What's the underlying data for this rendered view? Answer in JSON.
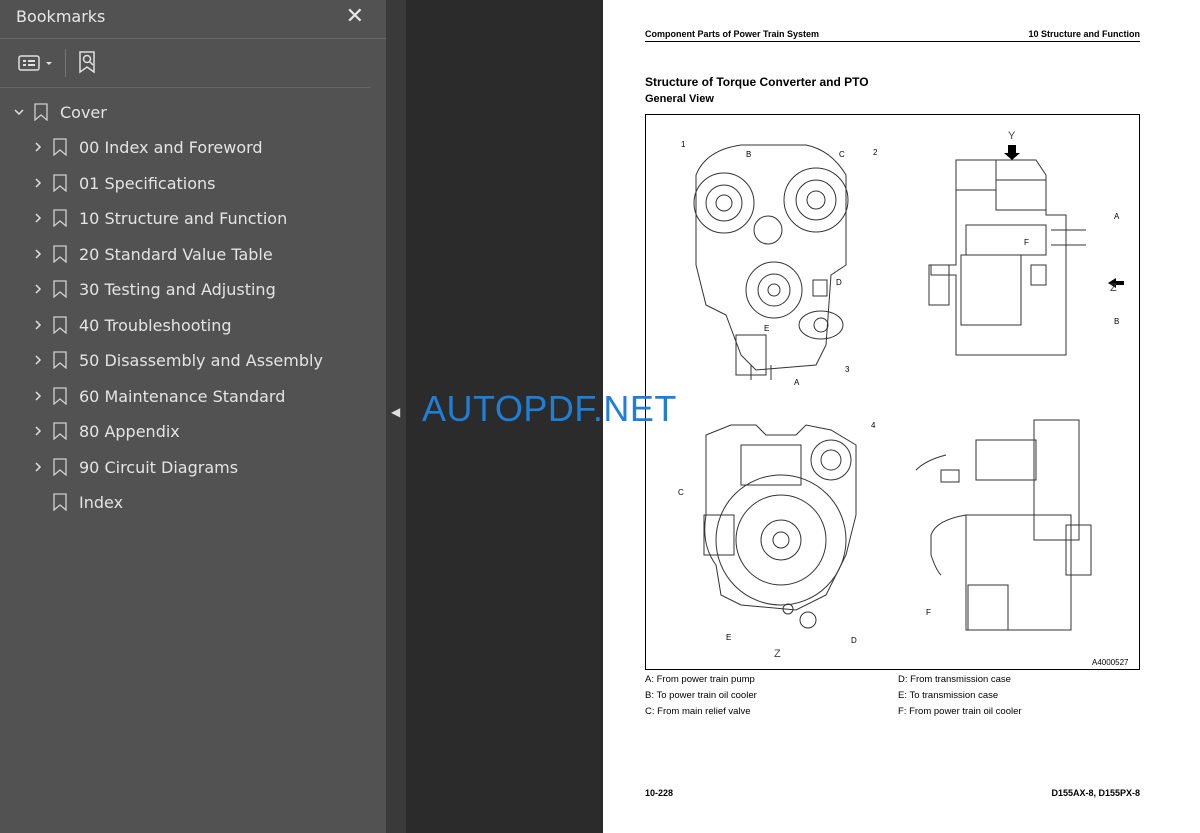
{
  "sidebar": {
    "title": "Bookmarks",
    "close_icon": "close-icon",
    "toolbar": {
      "options_icon": "list-options-icon",
      "search_icon": "bookmark-search-icon"
    },
    "items": [
      {
        "label": "Cover",
        "expanded": true
      },
      {
        "label": "00 Index and Foreword"
      },
      {
        "label": "01 Specifications"
      },
      {
        "label": "10 Structure and Function"
      },
      {
        "label": "20 Standard Value Table"
      },
      {
        "label": "30 Testing and Adjusting"
      },
      {
        "label": "40 Troubleshooting"
      },
      {
        "label": "50 Disassembly and Assembly"
      },
      {
        "label": "60 Maintenance Standard"
      },
      {
        "label": "80 Appendix"
      },
      {
        "label": "90 Circuit Diagrams"
      },
      {
        "label": "Index"
      }
    ]
  },
  "watermark": "AUTOPDF.NET",
  "page": {
    "header_left": "Component Parts of Power Train System",
    "header_right": "10 Structure and Function",
    "title": "Structure of Torque Converter and PTO",
    "subtitle": "General View",
    "figure": {
      "view_y": "Y",
      "view_z": "Z",
      "fig_id": "A4000527",
      "callouts": [
        "1",
        "2",
        "3",
        "4",
        "A",
        "B",
        "C",
        "D",
        "E",
        "F"
      ]
    },
    "legend": [
      "A: From power train pump",
      "B: To power train oil cooler",
      "C: From main relief valve",
      "D: From transmission case",
      "E: To transmission case",
      "F: From power train oil cooler"
    ],
    "footer_left": "10-228",
    "footer_right": "D155AX-8, D155PX-8"
  },
  "colors": {
    "sidebar_bg": "#525252",
    "viewer_bg": "#2b2b2b",
    "watermark": "#1f7fd6"
  }
}
